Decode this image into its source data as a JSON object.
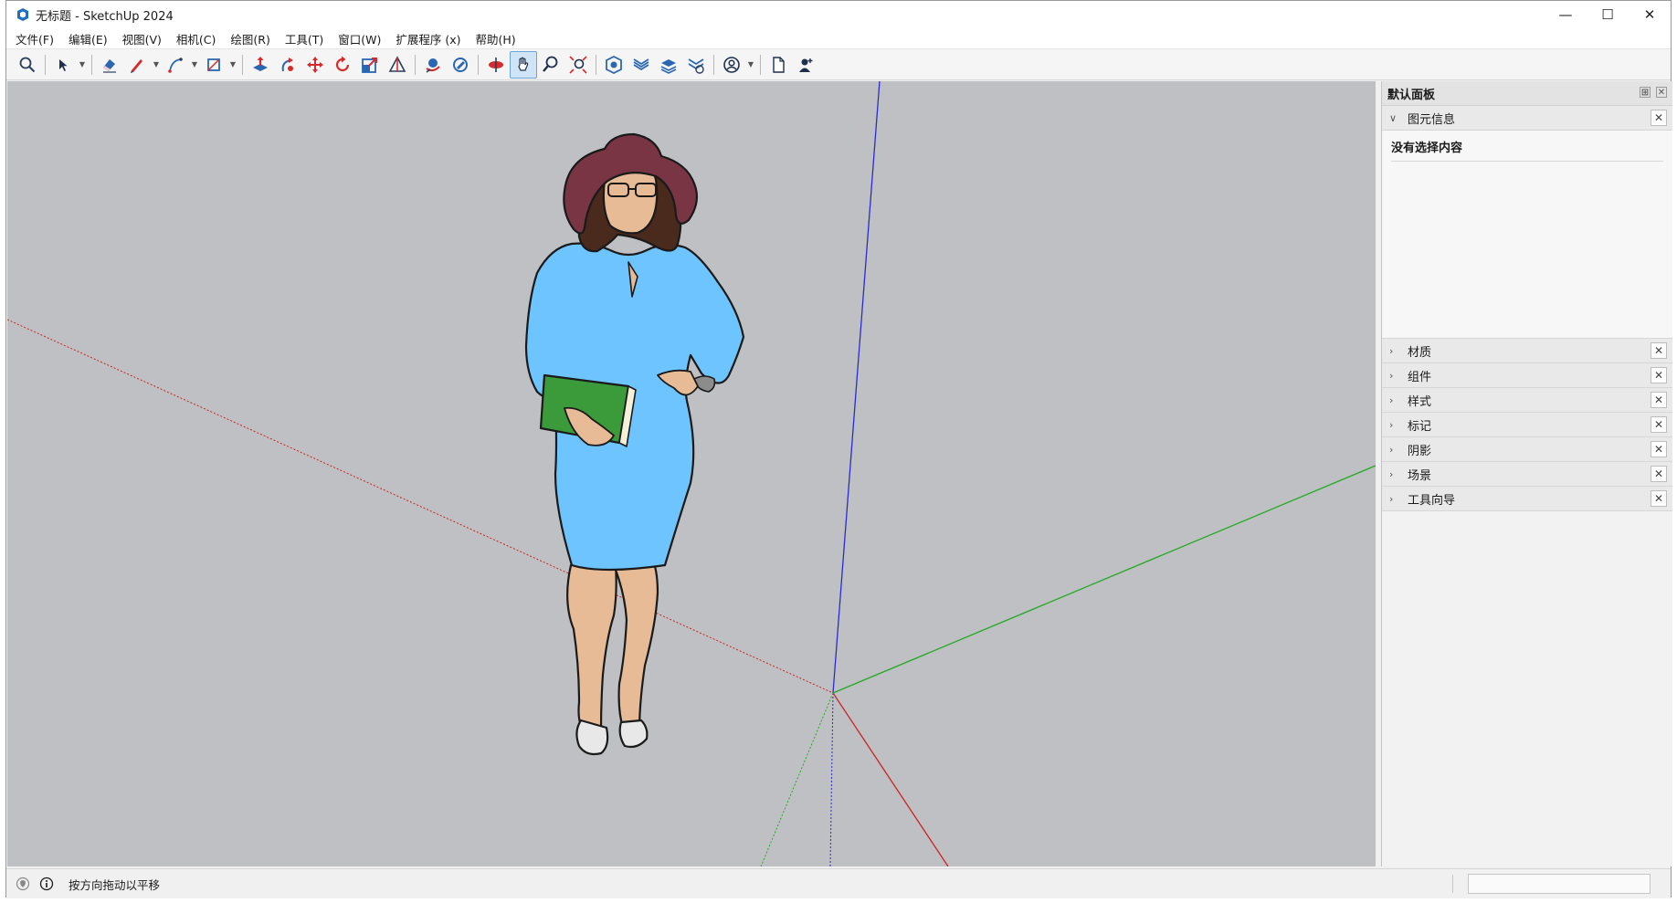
{
  "window": {
    "title": "无标题 - SketchUp 2024",
    "controls": {
      "minimize": "—",
      "maximize": "☐",
      "close": "✕"
    }
  },
  "menu": [
    "文件(F)",
    "编辑(E)",
    "视图(V)",
    "相机(C)",
    "绘图(R)",
    "工具(T)",
    "窗口(W)",
    "扩展程序 (x)",
    "帮助(H)"
  ],
  "toolbar": {
    "active_tool": "pan-tool",
    "icons": [
      "search-icon",
      "select-arrow-icon",
      "eraser-icon",
      "pencil-line-icon",
      "arc-icon",
      "rectangle-icon",
      "push-pull-icon",
      "follow-me-icon",
      "move-icon",
      "rotate-icon",
      "scale-icon",
      "protractor-icon",
      "orbit-icon",
      "paint-bucket-icon",
      "position-camera-icon",
      "pan-icon",
      "zoom-icon",
      "zoom-extents-icon",
      "warehouse-icon",
      "extension-warehouse-icon",
      "layout-icon",
      "solid-tools-icon",
      "account-icon",
      "new-file-icon",
      "add-user-icon"
    ]
  },
  "tray": {
    "title": "默认面板",
    "entity_info": {
      "label": "图元信息",
      "content": "没有选择内容"
    },
    "panels": [
      "材质",
      "组件",
      "样式",
      "标记",
      "阴影",
      "场景",
      "工具向导"
    ]
  },
  "status": {
    "text": "按方向拖动以平移"
  },
  "colors": {
    "axis_blue": "#2b2bcc",
    "axis_red": "#cc2222",
    "axis_green": "#22aa22",
    "dress": "#6ec4ff",
    "hat": "#7a3545",
    "skin": "#e6bb96",
    "hair": "#4a2a1c",
    "book": "#3b9b3b",
    "viewport_bg": "#bfc0c4"
  }
}
